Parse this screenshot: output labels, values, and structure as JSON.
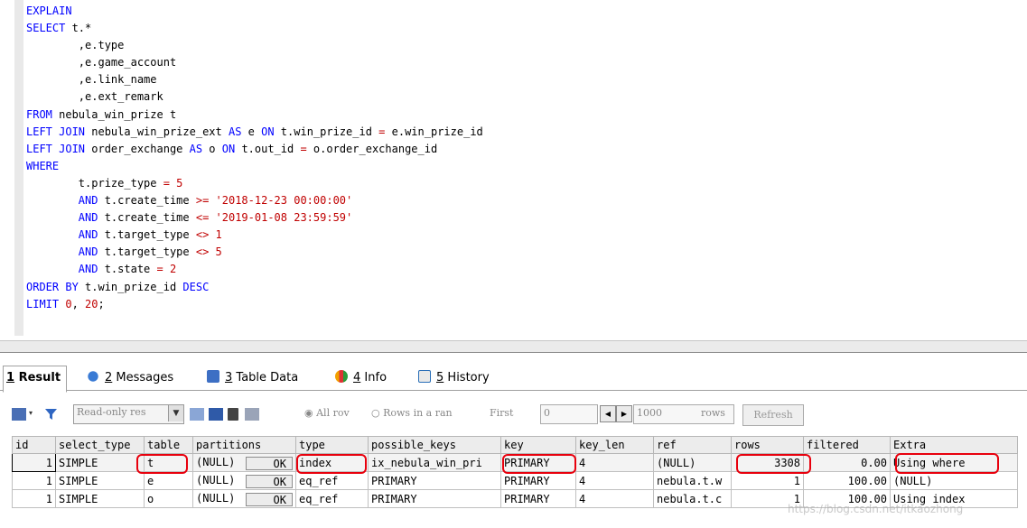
{
  "editor": {
    "lines": [
      [
        [
          "kw",
          "EXPLAIN"
        ]
      ],
      [
        [
          "kw",
          "SELECT"
        ],
        [
          "t",
          " t.*"
        ]
      ],
      [
        [
          "t",
          "        ,e.type"
        ]
      ],
      [
        [
          "t",
          "        ,e.game_account"
        ]
      ],
      [
        [
          "t",
          "        ,e.link_name"
        ]
      ],
      [
        [
          "t",
          "        ,e.ext_remark"
        ]
      ],
      [
        [
          "kw",
          "FROM"
        ],
        [
          "t",
          " nebula_win_prize t"
        ]
      ],
      [
        [
          "kw",
          "LEFT JOIN"
        ],
        [
          "t",
          " nebula_win_prize_ext "
        ],
        [
          "kw",
          "AS"
        ],
        [
          "t",
          " e "
        ],
        [
          "kw",
          "ON"
        ],
        [
          "t",
          " t.win_prize_id "
        ],
        [
          "op",
          "="
        ],
        [
          "t",
          " e.win_prize_id"
        ]
      ],
      [
        [
          "kw",
          "LEFT JOIN"
        ],
        [
          "t",
          " order_exchange "
        ],
        [
          "kw",
          "AS"
        ],
        [
          "t",
          " o "
        ],
        [
          "kw",
          "ON"
        ],
        [
          "t",
          " t.out_id "
        ],
        [
          "op",
          "="
        ],
        [
          "t",
          " o.order_exchange_id"
        ]
      ],
      [
        [
          "kw",
          "WHERE"
        ]
      ],
      [
        [
          "t",
          "        t.prize_type "
        ],
        [
          "op",
          "="
        ],
        [
          "num",
          " 5"
        ]
      ],
      [
        [
          "t",
          "        "
        ],
        [
          "kw",
          "AND"
        ],
        [
          "t",
          " t.create_time "
        ],
        [
          "op",
          ">="
        ],
        [
          "str",
          " '2018-12-23 00:00:00'"
        ]
      ],
      [
        [
          "t",
          "        "
        ],
        [
          "kw",
          "AND"
        ],
        [
          "t",
          " t.create_time "
        ],
        [
          "op",
          "<="
        ],
        [
          "str",
          " '2019-01-08 23:59:59'"
        ]
      ],
      [
        [
          "t",
          "        "
        ],
        [
          "kw",
          "AND"
        ],
        [
          "t",
          " t.target_type "
        ],
        [
          "op",
          "<>"
        ],
        [
          "num",
          " 1"
        ]
      ],
      [
        [
          "t",
          "        "
        ],
        [
          "kw",
          "AND"
        ],
        [
          "t",
          " t.target_type "
        ],
        [
          "op",
          "<>"
        ],
        [
          "num",
          " 5"
        ]
      ],
      [
        [
          "t",
          "        "
        ],
        [
          "kw",
          "AND"
        ],
        [
          "t",
          " t.state "
        ],
        [
          "op",
          "="
        ],
        [
          "num",
          " 2"
        ]
      ],
      [
        [
          "kw",
          "ORDER BY"
        ],
        [
          "t",
          " t.win_prize_id "
        ],
        [
          "kw",
          "DESC"
        ]
      ],
      [
        [
          "kw",
          "LIMIT"
        ],
        [
          "num",
          " 0"
        ],
        [
          "t",
          ", "
        ],
        [
          "num",
          "20"
        ],
        [
          "t",
          ";"
        ]
      ]
    ]
  },
  "tabs": [
    {
      "num": "1",
      "label": "Result",
      "icon": "result-grid-icon"
    },
    {
      "num": "2",
      "label": "Messages",
      "icon": "messages-info-icon"
    },
    {
      "num": "3",
      "label": "Table Data",
      "icon": "table-data-icon"
    },
    {
      "num": "4",
      "label": "Info",
      "icon": "info-icon"
    },
    {
      "num": "5",
      "label": "History",
      "icon": "history-icon"
    }
  ],
  "toolbar": {
    "mode_value": "Read-only res",
    "radio_all": "All rov",
    "radio_range": "Rows in a ran",
    "first_label": "First",
    "first_value": "0",
    "rows_value": "1000",
    "rows_label": "rows",
    "refresh_label": "Refresh"
  },
  "grid": {
    "columns": [
      "id",
      "select_type",
      "table",
      "partitions",
      "type",
      "possible_keys",
      "key",
      "key_len",
      "ref",
      "rows",
      "filtered",
      "Extra"
    ],
    "rows": [
      [
        "1",
        "SIMPLE",
        "t",
        "(NULL)",
        "index",
        "ix_nebula_win_pri",
        "PRIMARY",
        "4",
        "(NULL)",
        "3308",
        "0.00",
        "Using where"
      ],
      [
        "1",
        "SIMPLE",
        "e",
        "(NULL)",
        "eq_ref",
        "PRIMARY",
        "PRIMARY",
        "4",
        "nebula.t.w",
        "1",
        "100.00",
        "(NULL)"
      ],
      [
        "1",
        "SIMPLE",
        "o",
        "(NULL)",
        "eq_ref",
        "PRIMARY",
        "PRIMARY",
        "4",
        "nebula.t.c",
        "1",
        "100.00",
        "Using index"
      ]
    ],
    "partition_button": "OK"
  },
  "watermark": "https://blog.csdn.net/itkaozhong",
  "colors": {
    "keyword": "#0000ff",
    "string": "#c00000",
    "highlight": "#e8000d"
  }
}
